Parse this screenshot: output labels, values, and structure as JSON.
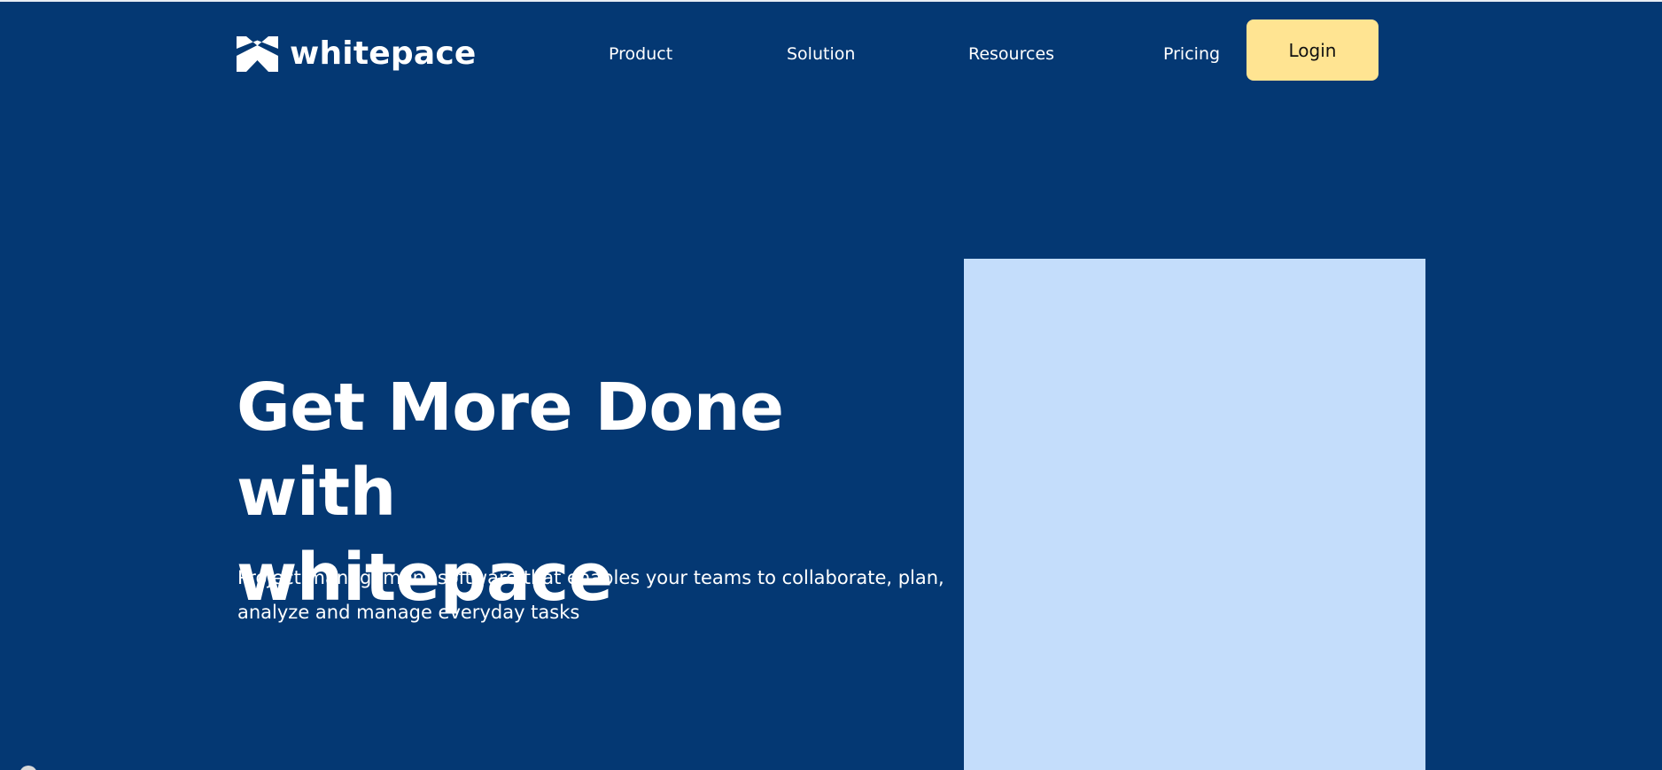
{
  "brand": {
    "name": "whitepace",
    "logo_icon": "whitepace-logo-icon",
    "colors": {
      "background": "#043873",
      "login_button": "#FFE492",
      "hero_image": "#C4DDFB",
      "text": "#FFFFFF"
    }
  },
  "nav": {
    "items": [
      "Product",
      "Solution",
      "Resources",
      "Pricing"
    ],
    "login_label": "Login"
  },
  "hero": {
    "title_line1": "Get More Done with",
    "title_line2": "whitepace",
    "subtitle": "Project management software that enables your teams to collaborate, plan, analyze and manage everyday tasks"
  }
}
